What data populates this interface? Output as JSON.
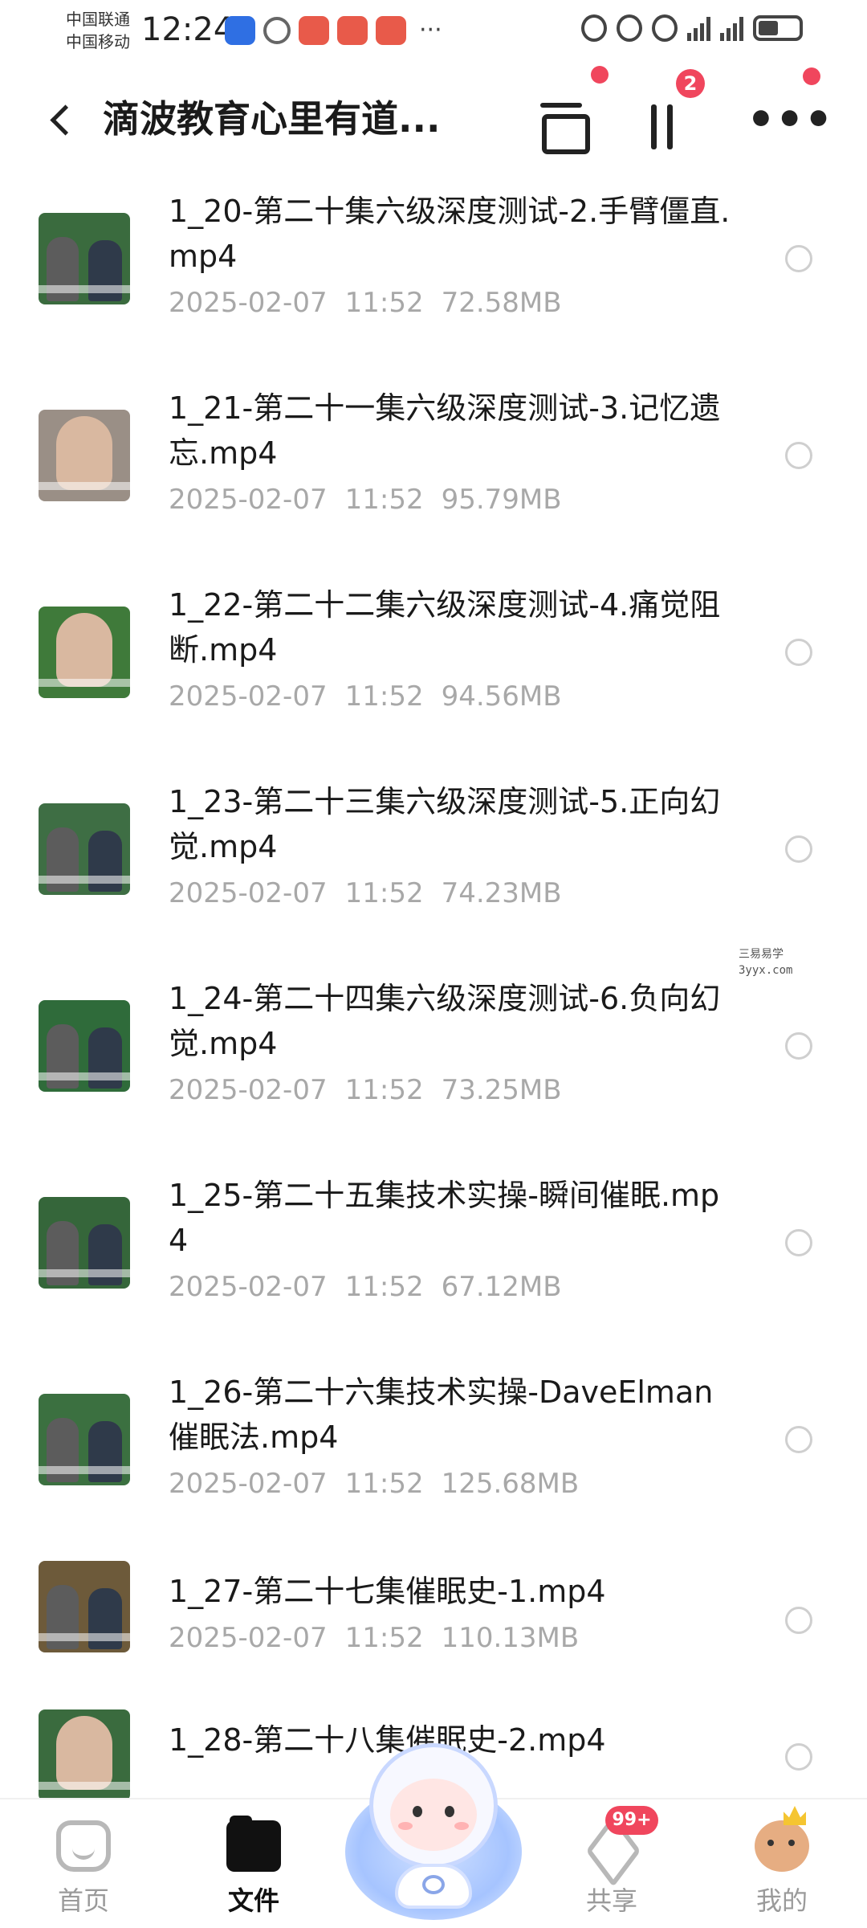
{
  "status_bar": {
    "carrier_1": "中国联通",
    "carrier_2": "中国移动",
    "time": "12:24",
    "dots": "···"
  },
  "header": {
    "title": "滴波教育心里有道...",
    "sort_badge": "2"
  },
  "files": [
    {
      "name": "1_20-第二十集六级深度测试-2.手臂僵直.mp4",
      "date": "2025-02-07",
      "time": "11:52",
      "size": "72.58MB",
      "thumb_color": "#3a6b3e"
    },
    {
      "name": "1_21-第二十一集六级深度测试-3.记忆遗忘.mp4",
      "date": "2025-02-07",
      "time": "11:52",
      "size": "95.79MB",
      "thumb_color": "#9a8f86"
    },
    {
      "name": "1_22-第二十二集六级深度测试-4.痛觉阻断.mp4",
      "date": "2025-02-07",
      "time": "11:52",
      "size": "94.56MB",
      "thumb_color": "#3f7a3a"
    },
    {
      "name": "1_23-第二十三集六级深度测试-5.正向幻觉.mp4",
      "date": "2025-02-07",
      "time": "11:52",
      "size": "74.23MB",
      "thumb_color": "#3e6e44"
    },
    {
      "name": "1_24-第二十四集六级深度测试-6.负向幻觉.mp4",
      "date": "2025-02-07",
      "time": "11:52",
      "size": "73.25MB",
      "thumb_color": "#2f6b3a"
    },
    {
      "name": "1_25-第二十五集技术实操-瞬间催眠.mp4",
      "date": "2025-02-07",
      "time": "11:52",
      "size": "67.12MB",
      "thumb_color": "#35663a"
    },
    {
      "name": "1_26-第二十六集技术实操-DaveElman催眠法.mp4",
      "date": "2025-02-07",
      "time": "11:52",
      "size": "125.68MB",
      "thumb_color": "#3b7040"
    },
    {
      "name": "1_27-第二十七集催眠史-1.mp4",
      "date": "2025-02-07",
      "time": "11:52",
      "size": "110.13MB",
      "thumb_color": "#6d5a3a"
    },
    {
      "name": "1_28-第二十八集催眠史-2.mp4",
      "date": "",
      "time": "",
      "size": "",
      "thumb_color": "#3a6b3e"
    }
  ],
  "watermark": {
    "line1": "三易易学",
    "line2": "3yyx.com"
  },
  "nav": {
    "home": "首页",
    "files": "文件",
    "share": "共享",
    "share_badge": "99+",
    "me": "我的"
  },
  "colors": {
    "accent_red": "#f0465d",
    "meta_gray": "#a8a8a8"
  }
}
